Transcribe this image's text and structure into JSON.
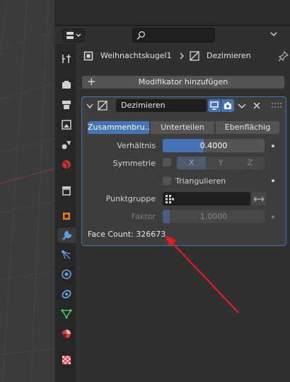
{
  "breadcrumb": {
    "object_name": "Weihnachtskugel1",
    "modifier_name": "Dezimieren"
  },
  "add_modifier_label": "Modifikator hinzufügen",
  "modifier": {
    "name": "Dezimieren",
    "tabs": [
      "Zusammenbru...",
      "Unterteilen",
      "Ebenflächig"
    ],
    "active_tab": 0,
    "ratio_label": "Verhältnis",
    "ratio_value": "0.4000",
    "ratio_fraction": 0.4,
    "symmetry_label": "Symmetrie",
    "axes": [
      "X",
      "Y",
      "Z"
    ],
    "triangulate_label": "Triangulieren",
    "vertex_group_label": "Punktgruppe",
    "factor_label": "Faktor",
    "factor_value": "1.0000",
    "face_count": "Face Count: 326673"
  },
  "colors": {
    "accent": "#4772b3",
    "annotation_arrow": "#e31c1c",
    "panel_border": "#4772b3"
  }
}
